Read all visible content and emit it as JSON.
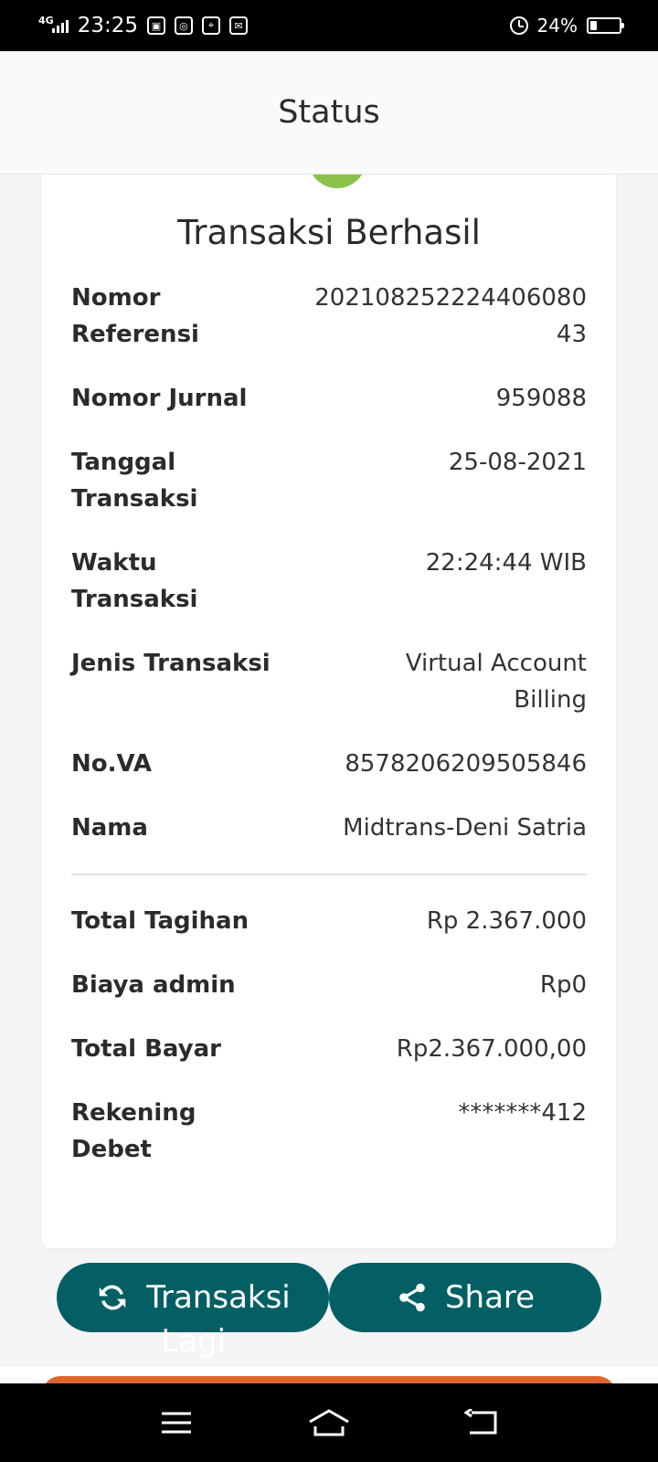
{
  "status_bar": {
    "network": "4G",
    "time": "23:25",
    "battery_percent": "24%",
    "battery_level": 0.24
  },
  "header": {
    "title": "Status"
  },
  "card": {
    "title": "Transaksi Berhasil",
    "details": [
      {
        "label_lines": [
          "Nomor",
          "Referensi"
        ],
        "value_lines": [
          "202108252224406080",
          "43"
        ]
      },
      {
        "label_lines": [
          "Nomor Jurnal"
        ],
        "value_lines": [
          "959088"
        ]
      },
      {
        "label_lines": [
          "Tanggal",
          "Transaksi"
        ],
        "value_lines": [
          "25-08-2021"
        ]
      },
      {
        "label_lines": [
          "Waktu",
          "Transaksi"
        ],
        "value_lines": [
          "22:24:44 WIB"
        ]
      },
      {
        "label_lines": [
          "Jenis Transaksi"
        ],
        "value_lines": [
          "Virtual Account",
          "Billing"
        ]
      },
      {
        "label_lines": [
          "No.VA"
        ],
        "value_lines": [
          "8578206209505846"
        ]
      },
      {
        "label_lines": [
          "Nama"
        ],
        "value_lines": [
          "Midtrans-Deni Satria"
        ]
      }
    ],
    "summary": [
      {
        "label_lines": [
          "Total Tagihan"
        ],
        "value_lines": [
          "Rp 2.367.000"
        ]
      },
      {
        "label_lines": [
          "Biaya admin"
        ],
        "value_lines": [
          "Rp0"
        ]
      },
      {
        "label_lines": [
          "Total Bayar"
        ],
        "value_lines": [
          "Rp2.367.000,00"
        ]
      },
      {
        "label_lines": [
          "Rekening",
          "Debet"
        ],
        "value_lines": [
          "*******412"
        ]
      }
    ]
  },
  "buttons": {
    "again_label_line1": "Transaksi",
    "again_label_line2": "Lagi",
    "share_label": "Share"
  },
  "colors": {
    "accent": "#045f65",
    "success": "#8bc34a",
    "orange": "#e0642d"
  },
  "icons": {
    "again": "refresh-icon",
    "share": "share-icon",
    "nav_menu": "menu-icon",
    "nav_home": "home-icon",
    "nav_back": "back-icon"
  }
}
